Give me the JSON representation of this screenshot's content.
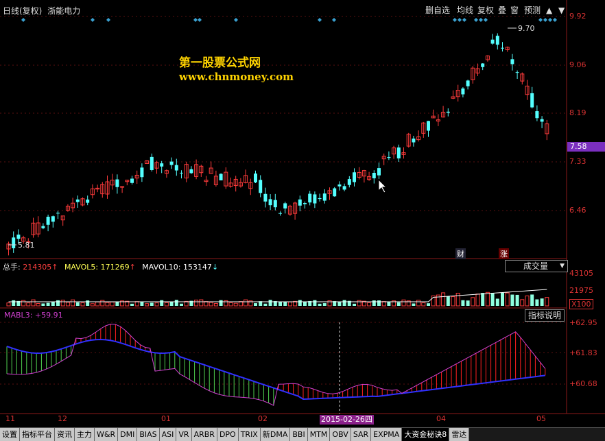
{
  "header": {
    "title": "日线(复权)",
    "stock_name": "浙能电力",
    "buttons": [
      "删自选",
      "均线",
      "复权",
      "叠",
      "窗",
      "预测"
    ]
  },
  "watermark": {
    "line1": "第一股票公式网",
    "line2": "www.chnmoney.com"
  },
  "price_axis": {
    "labels": [
      "9.92",
      "9.06",
      "8.19",
      "7.33",
      "6.46"
    ],
    "current": "7.58",
    "current_color": "#7b2fbf"
  },
  "price_annotations": {
    "high": "9.70",
    "low": "5.81",
    "badge_cai": "财",
    "badge_zhang": "涨"
  },
  "volume_panel": {
    "total_label": "总手:",
    "total_value": "214305",
    "mavol5_label": "MAVOL5:",
    "mavol5_value": "171269",
    "mavol10_label": "MAVOL10:",
    "mavol10_value": "153147",
    "dropdown": "成交量",
    "axis_labels": [
      "43105",
      "21975"
    ],
    "unit": "X100"
  },
  "indicator_panel": {
    "name_label": "MABL3:",
    "name_value": "+59.91",
    "help_button": "指标说明",
    "axis_labels": [
      "+62.95",
      "+61.83",
      "+60.68"
    ]
  },
  "time_axis": {
    "labels": [
      "11",
      "12",
      "01",
      "02",
      "04",
      "05"
    ],
    "cursor_date": "2015-02-26",
    "cursor_weekday": "四"
  },
  "bottom_tabs": [
    "设置",
    "指标平台",
    "资讯",
    "主力",
    "W&R",
    "DMI",
    "BIAS",
    "ASI",
    "VR",
    "ARBR",
    "DPO",
    "TRIX",
    "新DMA",
    "BBI",
    "MTM",
    "OBV",
    "SAR",
    "EXPMA",
    "大资金秘诀8",
    "雷达"
  ],
  "colors": {
    "up": "#ff3b3b",
    "down": "#54ffff",
    "ma_line": "#ffffff",
    "indicator_red": "#ff2020",
    "indicator_blue": "#3030ff",
    "indicator_purple": "#d040d0",
    "watermark": "#ffd400"
  }
}
